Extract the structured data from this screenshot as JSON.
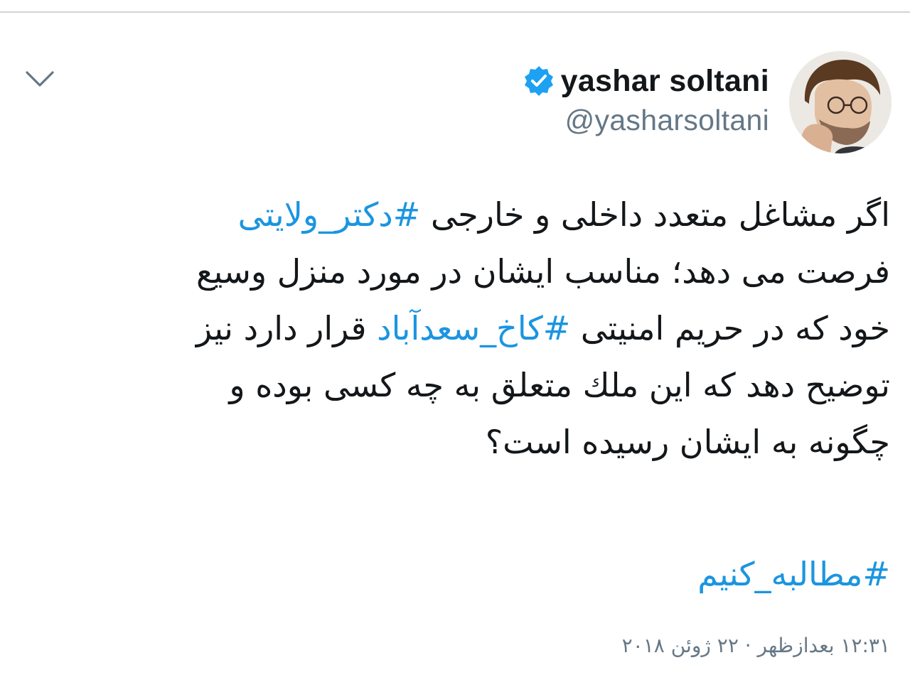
{
  "tweet": {
    "author": {
      "display_name": "yashar soltani",
      "handle": "@yasharsoltani",
      "verified": true,
      "verified_icon": "verified-badge-icon",
      "verified_color": "#1da1f2"
    },
    "lines": [
      {
        "text_before": "اگر مشاغل متعدد داخلی و خارجی ",
        "hashtag": "#دکتر_ولایتی",
        "text_after": ""
      },
      {
        "text_before": "فرصت می دهد؛ مناسب ایشان در مورد منزل وسیع",
        "hashtag": "",
        "text_after": ""
      },
      {
        "text_before": "خود که در حریم امنیتی ",
        "hashtag": "#کاخ_سعدآباد",
        "text_after": " قرار دارد نیز"
      },
      {
        "text_before": "توضیح دهد که این ملك متعلق به چه کسی بوده و",
        "hashtag": "",
        "text_after": ""
      },
      {
        "text_before": "چگونه به ایشان رسیده است؟",
        "hashtag": "",
        "text_after": ""
      }
    ],
    "footer_hashtag": "#مطالبه_کنیم",
    "timestamp": "۱۲:۳۱ بعدازظهر · ۲۲ ژوئن ۲۰۱۸"
  },
  "icons": {
    "menu": "chevron-down-icon",
    "avatar": "profile-avatar"
  },
  "colors": {
    "text": "#14171a",
    "secondary": "#657786",
    "hashtag": "#1b95e0",
    "chevron": "#657786"
  }
}
